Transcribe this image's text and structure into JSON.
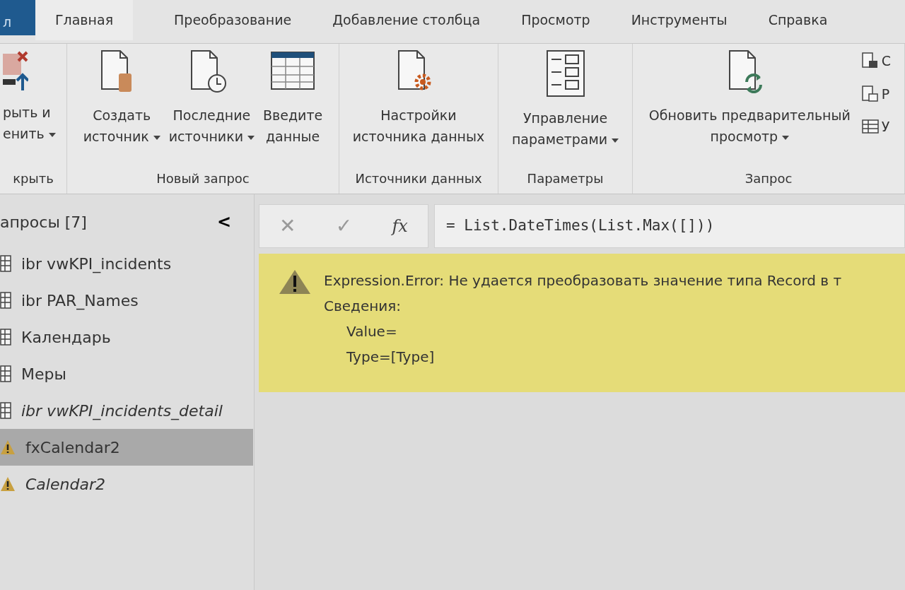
{
  "file_tab": {
    "label": "л"
  },
  "tabs": [
    {
      "label": "Главная",
      "selected": true
    },
    {
      "label": "Преобразование",
      "selected": false
    },
    {
      "label": "Добавление столбца",
      "selected": false
    },
    {
      "label": "Просмотр",
      "selected": false
    },
    {
      "label": "Инструменты",
      "selected": false
    },
    {
      "label": "Справка",
      "selected": false
    }
  ],
  "ribbon_groups": [
    {
      "label": "крыть",
      "buttons": [
        {
          "kind": "close-apply",
          "lines": [
            "рыть и",
            "енить"
          ],
          "dropdown": true
        }
      ]
    },
    {
      "label": "Новый запрос",
      "buttons": [
        {
          "kind": "new-source",
          "lines": [
            "Создать",
            "источник"
          ],
          "dropdown": true
        },
        {
          "kind": "recent",
          "lines": [
            "Последние",
            "источники"
          ],
          "dropdown": true
        },
        {
          "kind": "enter-data",
          "lines": [
            "Введите",
            "данные"
          ],
          "dropdown": false
        }
      ]
    },
    {
      "label": "Источники данных",
      "buttons": [
        {
          "kind": "source-settings",
          "lines": [
            "Настройки",
            "источника данных"
          ],
          "dropdown": false
        }
      ]
    },
    {
      "label": "Параметры",
      "buttons": [
        {
          "kind": "parameters",
          "lines": [
            "Управление",
            "параметрами"
          ],
          "dropdown": true
        }
      ]
    },
    {
      "label": "Запрос",
      "buttons": [
        {
          "kind": "refresh",
          "lines": [
            "Обновить предварительный",
            "просмотр"
          ],
          "dropdown": true
        }
      ],
      "small_buttons": [
        {
          "kind": "properties",
          "label": "С"
        },
        {
          "kind": "editor",
          "label": "Р"
        },
        {
          "kind": "manage",
          "label": "У"
        }
      ]
    }
  ],
  "queries_pane": {
    "title": "апросы [7]",
    "collapse": "<",
    "items": [
      {
        "name": "ibr vwKPI_incidents",
        "kind": "table",
        "italic": false,
        "selected": false
      },
      {
        "name": "ibr PAR_Names",
        "kind": "table",
        "italic": false,
        "selected": false
      },
      {
        "name": "Календарь",
        "kind": "table",
        "italic": false,
        "selected": false
      },
      {
        "name": "Меры",
        "kind": "table",
        "italic": false,
        "selected": false
      },
      {
        "name": "ibr vwKPI_incidents_detail",
        "kind": "table",
        "italic": true,
        "selected": false
      },
      {
        "name": "fxCalendar2",
        "kind": "warning",
        "italic": false,
        "selected": true
      },
      {
        "name": "Calendar2",
        "kind": "warning",
        "italic": true,
        "selected": false
      }
    ]
  },
  "formula_bar": {
    "cancel": "✕",
    "confirm": "✓",
    "fx": "fx",
    "formula": "= List.DateTimes(List.Max([]))"
  },
  "error": {
    "message": "Expression.Error: Не удается преобразовать значение типа Record в т",
    "details_label": "Сведения:",
    "details": [
      "Value=",
      "Type=[Type]"
    ]
  }
}
